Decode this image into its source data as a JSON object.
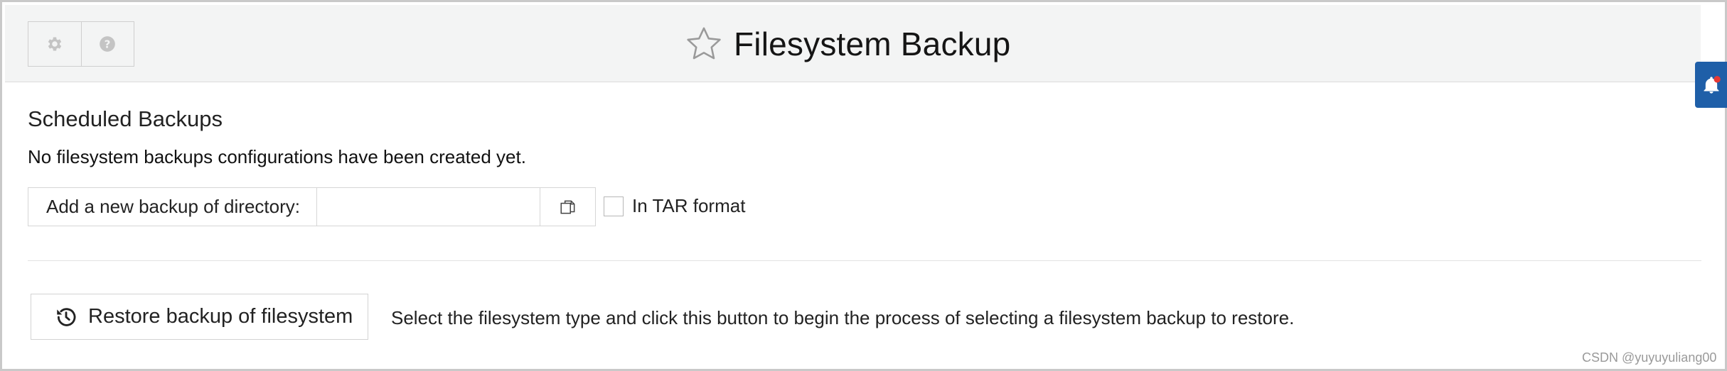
{
  "header": {
    "title": "Filesystem Backup",
    "buttons": [
      {
        "icon": "gear-icon"
      },
      {
        "icon": "question-circle-icon"
      }
    ],
    "favorite_icon": "star-outline-icon"
  },
  "side_tab": {
    "icon": "bell-icon",
    "color": "#1f5fa8"
  },
  "scheduled": {
    "title": "Scheduled Backups",
    "empty_message": "No filesystem backups configurations have been created yet."
  },
  "add_backup": {
    "label": "Add a new backup of directory:",
    "input_value": "",
    "input_placeholder": "",
    "chooser_icon": "file-chooser-icon",
    "tar_label": "In TAR format",
    "tar_checked": false
  },
  "restore": {
    "button_label": "Restore backup of filesystem",
    "button_icon": "history-icon",
    "help_text": "Select the filesystem type and click this button to begin the process of selecting a filesystem backup to restore."
  },
  "watermark": "CSDN @yuyuyuliang00"
}
